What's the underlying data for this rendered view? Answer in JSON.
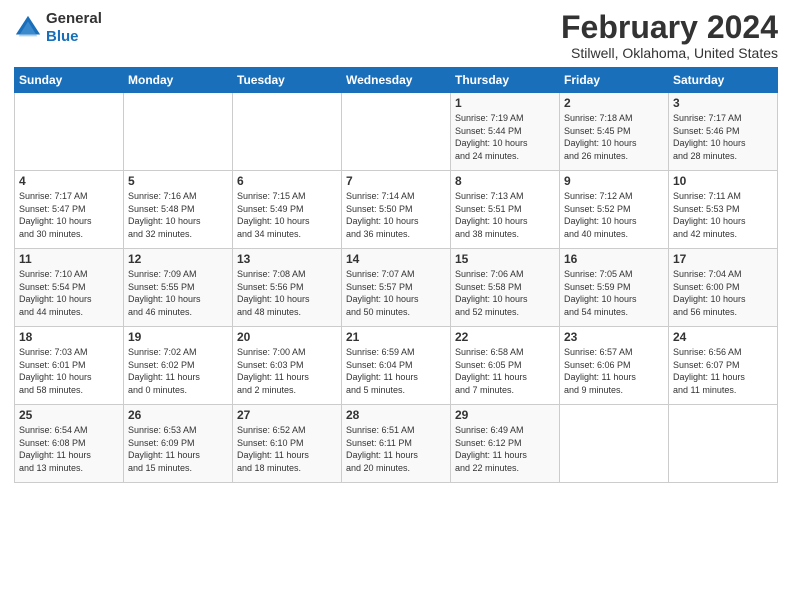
{
  "logo": {
    "line1": "General",
    "line2": "Blue"
  },
  "header": {
    "month": "February 2024",
    "location": "Stilwell, Oklahoma, United States"
  },
  "weekdays": [
    "Sunday",
    "Monday",
    "Tuesday",
    "Wednesday",
    "Thursday",
    "Friday",
    "Saturday"
  ],
  "weeks": [
    [
      {
        "day": "",
        "info": ""
      },
      {
        "day": "",
        "info": ""
      },
      {
        "day": "",
        "info": ""
      },
      {
        "day": "",
        "info": ""
      },
      {
        "day": "1",
        "info": "Sunrise: 7:19 AM\nSunset: 5:44 PM\nDaylight: 10 hours\nand 24 minutes."
      },
      {
        "day": "2",
        "info": "Sunrise: 7:18 AM\nSunset: 5:45 PM\nDaylight: 10 hours\nand 26 minutes."
      },
      {
        "day": "3",
        "info": "Sunrise: 7:17 AM\nSunset: 5:46 PM\nDaylight: 10 hours\nand 28 minutes."
      }
    ],
    [
      {
        "day": "4",
        "info": "Sunrise: 7:17 AM\nSunset: 5:47 PM\nDaylight: 10 hours\nand 30 minutes."
      },
      {
        "day": "5",
        "info": "Sunrise: 7:16 AM\nSunset: 5:48 PM\nDaylight: 10 hours\nand 32 minutes."
      },
      {
        "day": "6",
        "info": "Sunrise: 7:15 AM\nSunset: 5:49 PM\nDaylight: 10 hours\nand 34 minutes."
      },
      {
        "day": "7",
        "info": "Sunrise: 7:14 AM\nSunset: 5:50 PM\nDaylight: 10 hours\nand 36 minutes."
      },
      {
        "day": "8",
        "info": "Sunrise: 7:13 AM\nSunset: 5:51 PM\nDaylight: 10 hours\nand 38 minutes."
      },
      {
        "day": "9",
        "info": "Sunrise: 7:12 AM\nSunset: 5:52 PM\nDaylight: 10 hours\nand 40 minutes."
      },
      {
        "day": "10",
        "info": "Sunrise: 7:11 AM\nSunset: 5:53 PM\nDaylight: 10 hours\nand 42 minutes."
      }
    ],
    [
      {
        "day": "11",
        "info": "Sunrise: 7:10 AM\nSunset: 5:54 PM\nDaylight: 10 hours\nand 44 minutes."
      },
      {
        "day": "12",
        "info": "Sunrise: 7:09 AM\nSunset: 5:55 PM\nDaylight: 10 hours\nand 46 minutes."
      },
      {
        "day": "13",
        "info": "Sunrise: 7:08 AM\nSunset: 5:56 PM\nDaylight: 10 hours\nand 48 minutes."
      },
      {
        "day": "14",
        "info": "Sunrise: 7:07 AM\nSunset: 5:57 PM\nDaylight: 10 hours\nand 50 minutes."
      },
      {
        "day": "15",
        "info": "Sunrise: 7:06 AM\nSunset: 5:58 PM\nDaylight: 10 hours\nand 52 minutes."
      },
      {
        "day": "16",
        "info": "Sunrise: 7:05 AM\nSunset: 5:59 PM\nDaylight: 10 hours\nand 54 minutes."
      },
      {
        "day": "17",
        "info": "Sunrise: 7:04 AM\nSunset: 6:00 PM\nDaylight: 10 hours\nand 56 minutes."
      }
    ],
    [
      {
        "day": "18",
        "info": "Sunrise: 7:03 AM\nSunset: 6:01 PM\nDaylight: 10 hours\nand 58 minutes."
      },
      {
        "day": "19",
        "info": "Sunrise: 7:02 AM\nSunset: 6:02 PM\nDaylight: 11 hours\nand 0 minutes."
      },
      {
        "day": "20",
        "info": "Sunrise: 7:00 AM\nSunset: 6:03 PM\nDaylight: 11 hours\nand 2 minutes."
      },
      {
        "day": "21",
        "info": "Sunrise: 6:59 AM\nSunset: 6:04 PM\nDaylight: 11 hours\nand 5 minutes."
      },
      {
        "day": "22",
        "info": "Sunrise: 6:58 AM\nSunset: 6:05 PM\nDaylight: 11 hours\nand 7 minutes."
      },
      {
        "day": "23",
        "info": "Sunrise: 6:57 AM\nSunset: 6:06 PM\nDaylight: 11 hours\nand 9 minutes."
      },
      {
        "day": "24",
        "info": "Sunrise: 6:56 AM\nSunset: 6:07 PM\nDaylight: 11 hours\nand 11 minutes."
      }
    ],
    [
      {
        "day": "25",
        "info": "Sunrise: 6:54 AM\nSunset: 6:08 PM\nDaylight: 11 hours\nand 13 minutes."
      },
      {
        "day": "26",
        "info": "Sunrise: 6:53 AM\nSunset: 6:09 PM\nDaylight: 11 hours\nand 15 minutes."
      },
      {
        "day": "27",
        "info": "Sunrise: 6:52 AM\nSunset: 6:10 PM\nDaylight: 11 hours\nand 18 minutes."
      },
      {
        "day": "28",
        "info": "Sunrise: 6:51 AM\nSunset: 6:11 PM\nDaylight: 11 hours\nand 20 minutes."
      },
      {
        "day": "29",
        "info": "Sunrise: 6:49 AM\nSunset: 6:12 PM\nDaylight: 11 hours\nand 22 minutes."
      },
      {
        "day": "",
        "info": ""
      },
      {
        "day": "",
        "info": ""
      }
    ]
  ]
}
